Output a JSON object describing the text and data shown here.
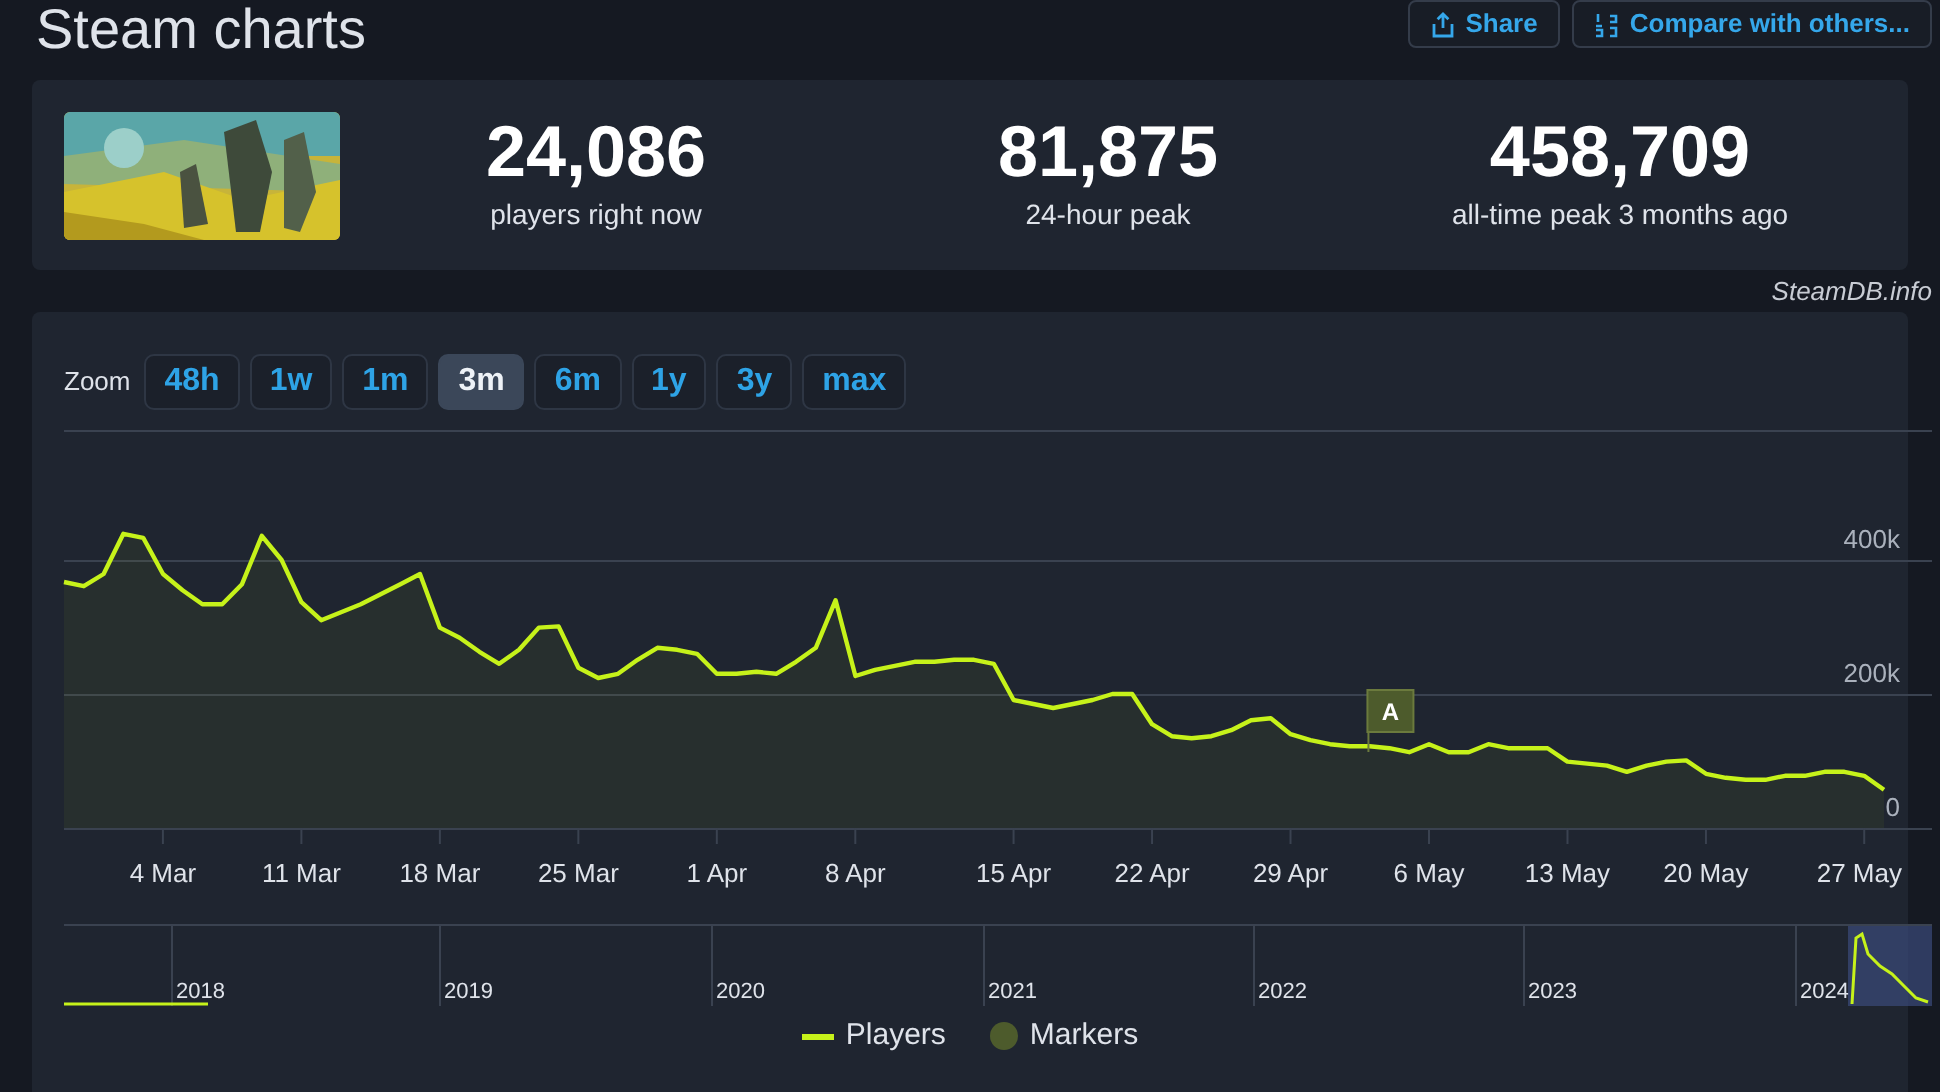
{
  "header": {
    "title": "Steam charts",
    "buttons": [
      {
        "kind": "share",
        "label": "Share"
      },
      {
        "kind": "compare",
        "label": "Compare with others..."
      }
    ]
  },
  "stats": [
    {
      "value": "24,086",
      "label": "players right now"
    },
    {
      "value": "81,875",
      "label": "24-hour peak"
    },
    {
      "value": "458,709",
      "label": "all-time peak 3 months ago"
    }
  ],
  "credit": "SteamDB.info",
  "zoom": {
    "label": "Zoom",
    "options": [
      {
        "label": "48h",
        "selected": false
      },
      {
        "label": "1w",
        "selected": false
      },
      {
        "label": "1m",
        "selected": false
      },
      {
        "label": "3m",
        "selected": true
      },
      {
        "label": "6m",
        "selected": false
      },
      {
        "label": "1y",
        "selected": false
      },
      {
        "label": "3y",
        "selected": false
      },
      {
        "label": "max",
        "selected": false
      }
    ]
  },
  "chart": {
    "chart_data": {
      "type": "area",
      "categories": [
        null,
        null,
        null,
        null,
        null,
        "4 Mar",
        null,
        null,
        null,
        null,
        null,
        null,
        "11 Mar",
        null,
        null,
        null,
        null,
        null,
        null,
        "18 Mar",
        null,
        null,
        null,
        null,
        null,
        null,
        "25 Mar",
        null,
        null,
        null,
        null,
        null,
        null,
        "1 Apr",
        null,
        null,
        null,
        null,
        null,
        null,
        "8 Apr",
        null,
        null,
        null,
        null,
        null,
        null,
        null,
        "15 Apr",
        null,
        null,
        null,
        null,
        null,
        null,
        "22 Apr",
        null,
        null,
        null,
        null,
        null,
        null,
        "29 Apr",
        null,
        null,
        null,
        null,
        null,
        null,
        "6 May",
        null,
        null,
        null,
        null,
        null,
        null,
        "13 May",
        null,
        null,
        null,
        null,
        null,
        null,
        "20 May",
        null,
        null,
        null,
        null,
        null,
        null,
        null,
        "27 May",
        null
      ],
      "series": [
        {
          "name": "Players",
          "color": "#c6f21a",
          "values": [
            367000,
            361000,
            379000,
            439000,
            433000,
            379000,
            355000,
            334000,
            334000,
            364000,
            436000,
            400000,
            337000,
            310000,
            322000,
            334000,
            349000,
            364000,
            379000,
            299000,
            284000,
            263000,
            245000,
            266000,
            299000,
            301000,
            239000,
            224000,
            230000,
            251000,
            269000,
            266000,
            260000,
            230000,
            230000,
            233000,
            230000,
            248000,
            269000,
            340000,
            227000,
            236000,
            242000,
            248000,
            248000,
            251000,
            251000,
            245000,
            191000,
            185000,
            179000,
            185000,
            191000,
            200000,
            200000,
            155000,
            137000,
            134000,
            137000,
            146000,
            161000,
            164000,
            140000,
            131000,
            125000,
            122000,
            122000,
            119000,
            113000,
            125000,
            113000,
            113000,
            125000,
            119000,
            119000,
            119000,
            99000,
            96000,
            93000,
            84000,
            93000,
            99000,
            101000,
            81000,
            75000,
            72000,
            72000,
            78000,
            78000,
            84000,
            84000,
            78000,
            57000
          ]
        }
      ],
      "ylim": [
        0,
        594000
      ],
      "yticks": [
        {
          "value": 0,
          "label": "0"
        },
        {
          "value": 200000,
          "label": "200k"
        },
        {
          "value": 400000,
          "label": "400k"
        }
      ],
      "annotations": [
        {
          "text": "A"
        }
      ]
    }
  },
  "navigator": {
    "years": [
      "2018",
      "2019",
      "2020",
      "2021",
      "2022",
      "2023",
      "2024"
    ]
  },
  "legend": [
    {
      "kind": "dot",
      "label": "Markers",
      "color": "#4d5b2c"
    }
  ]
}
